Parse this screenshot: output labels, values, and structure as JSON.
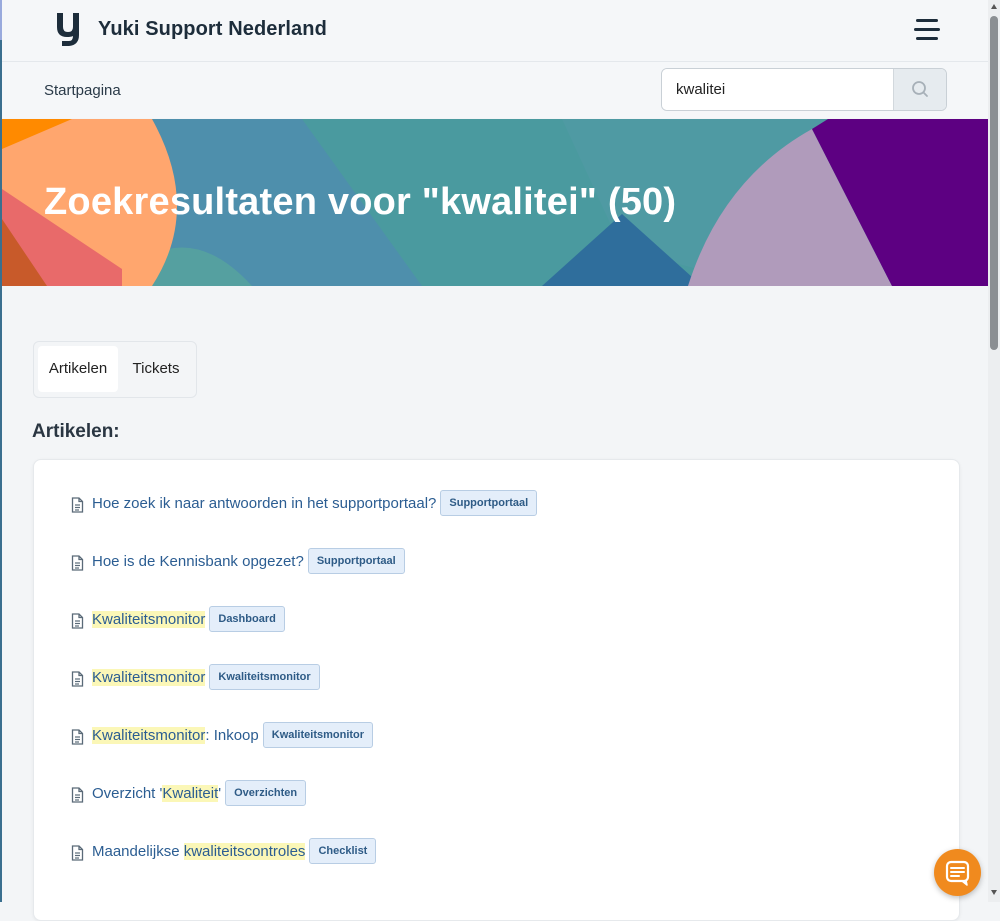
{
  "header": {
    "brand": "Yuki Support Nederland",
    "logo_icon": "yuki-logo",
    "menu_icon": "hamburger-icon"
  },
  "nav": {
    "breadcrumb": "Startpagina",
    "search": {
      "value": "kwalitei",
      "icon": "search-icon"
    }
  },
  "hero": {
    "title": "Zoekresultaten voor \"kwalitei\" (50)",
    "colors": [
      "#ff8a00",
      "#ffa66e",
      "#e86a6a",
      "#c85a2a",
      "#4e8fac",
      "#4aa3a3",
      "#2f6e9c",
      "#b09bbb",
      "#5d0082"
    ]
  },
  "tabs": [
    {
      "label": "Artikelen",
      "active": true
    },
    {
      "label": "Tickets",
      "active": false
    }
  ],
  "section_title": "Artikelen:",
  "results": [
    {
      "parts": [
        {
          "text": "Hoe zoek ik naar antwoorden in het supportportaal?",
          "hl": false
        }
      ],
      "badge": "Supportportaal"
    },
    {
      "parts": [
        {
          "text": "Hoe is de Kennisbank opgezet?",
          "hl": false
        }
      ],
      "badge": "Supportportaal"
    },
    {
      "parts": [
        {
          "text": "Kwaliteitsmonitor",
          "hl": true
        }
      ],
      "badge": "Dashboard"
    },
    {
      "parts": [
        {
          "text": "Kwaliteitsmonitor",
          "hl": true
        }
      ],
      "badge": "Kwaliteitsmonitor"
    },
    {
      "parts": [
        {
          "text": "Kwaliteitsmonitor",
          "hl": true
        },
        {
          "text": ": Inkoop",
          "hl": false
        }
      ],
      "badge": "Kwaliteitsmonitor"
    },
    {
      "parts": [
        {
          "text": "Overzicht '",
          "hl": false
        },
        {
          "text": "Kwaliteit",
          "hl": true
        },
        {
          "text": "'",
          "hl": false
        }
      ],
      "badge": "Overzichten"
    },
    {
      "parts": [
        {
          "text": "Maandelijkse ",
          "hl": false
        },
        {
          "text": "kwaliteitscontroles",
          "hl": true
        }
      ],
      "badge": "Checklist"
    }
  ],
  "result_icon": "document-icon",
  "chat": {
    "icon": "chat-icon"
  },
  "colors": {
    "accent": "#f08a1e",
    "link": "#2b5d92",
    "highlight": "#fbf7b7"
  }
}
